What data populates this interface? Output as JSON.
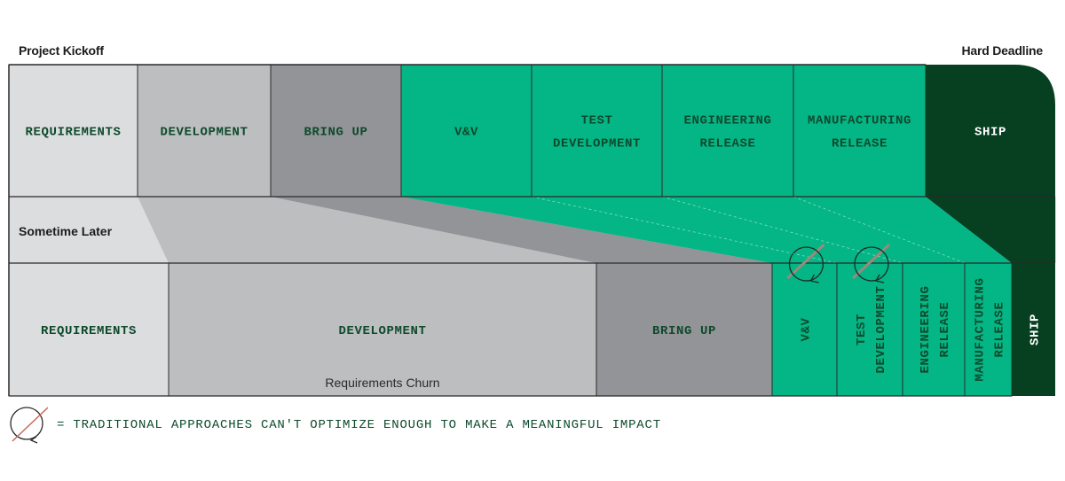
{
  "labels": {
    "start": "Project Kickoff",
    "end": "Hard Deadline",
    "middle_band": "Sometime Later",
    "churn": "Requirements Churn"
  },
  "colors": {
    "requirements": "#dcdddf",
    "development": "#bdbec0",
    "bring_up": "#939497",
    "green": "#04b586",
    "ship": "#073f21",
    "text_dark_green": "#0e4a2c",
    "no_optimize_slash": "#c9665a"
  },
  "top_row": {
    "name": "planned-schedule",
    "phases": [
      {
        "id": "requirements",
        "lines": [
          "REQUIREMENTS"
        ]
      },
      {
        "id": "development",
        "lines": [
          "DEVELOPMENT"
        ]
      },
      {
        "id": "bring-up",
        "lines": [
          "BRING UP"
        ]
      },
      {
        "id": "vv",
        "lines": [
          "V&V"
        ]
      },
      {
        "id": "test-development",
        "lines": [
          "TEST",
          "DEVELOPMENT"
        ]
      },
      {
        "id": "engineering-release",
        "lines": [
          "ENGINEERING",
          "RELEASE"
        ]
      },
      {
        "id": "manufacturing-release",
        "lines": [
          "MANUFACTURING",
          "RELEASE"
        ]
      },
      {
        "id": "ship",
        "lines": [
          "SHIP"
        ]
      }
    ]
  },
  "bottom_row": {
    "name": "actual-schedule",
    "phases": [
      {
        "id": "requirements",
        "lines": [
          "REQUIREMENTS"
        ]
      },
      {
        "id": "development",
        "lines": [
          "DEVELOPMENT"
        ]
      },
      {
        "id": "bring-up",
        "lines": [
          "BRING UP"
        ]
      },
      {
        "id": "vv",
        "lines": [
          "V&V"
        ],
        "no_optimize": true
      },
      {
        "id": "test-development",
        "lines": [
          "TEST",
          "DEVELOPMENT"
        ],
        "no_optimize": true
      },
      {
        "id": "engineering-release",
        "lines": [
          "ENGINEERING",
          "RELEASE"
        ]
      },
      {
        "id": "manufacturing-release",
        "lines": [
          "MANUFACTURING",
          "RELEASE"
        ]
      },
      {
        "id": "ship",
        "lines": [
          "SHIP"
        ]
      }
    ]
  },
  "legend": {
    "icon": "no-optimize-cycle-icon",
    "text": "= TRADITIONAL APPROACHES CAN'T OPTIMIZE ENOUGH TO MAKE A MEANINGFUL IMPACT"
  }
}
